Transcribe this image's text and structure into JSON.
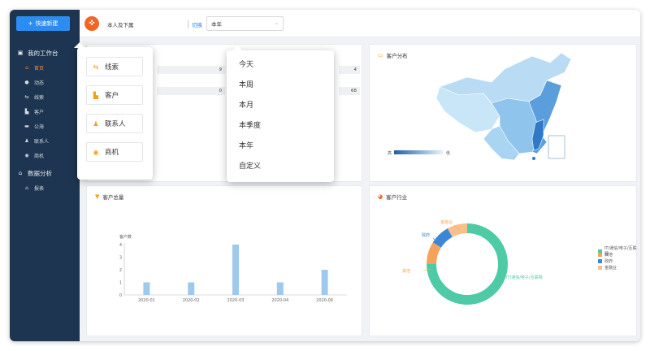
{
  "sidebar": {
    "quick_add": "快速新建",
    "items": [
      {
        "label": "我的工作台",
        "icon": "desktop-icon",
        "glyph": "▣",
        "group": true
      },
      {
        "label": "首页",
        "icon": "home-icon",
        "glyph": "⌂",
        "active": true
      },
      {
        "label": "动态",
        "icon": "chat-icon",
        "glyph": "●"
      },
      {
        "label": "线索",
        "icon": "link-icon",
        "glyph": "⇆"
      },
      {
        "label": "客户",
        "icon": "building-icon",
        "glyph": "▙"
      },
      {
        "label": "公海",
        "icon": "sea-icon",
        "glyph": "▬"
      },
      {
        "label": "联系人",
        "icon": "person-icon",
        "glyph": "♟"
      },
      {
        "label": "商机",
        "icon": "coin-icon",
        "glyph": "◉"
      },
      {
        "label": "数据分析",
        "icon": "home-icon",
        "glyph": "⌂",
        "group": true
      },
      {
        "label": "报表",
        "icon": "home-icon",
        "glyph": "⌂"
      }
    ]
  },
  "topbar": {
    "logo_glyph": "✜",
    "scope": "本人及下属",
    "switch": "切换",
    "period": "本年",
    "arrow": "⌄"
  },
  "panels": {
    "distribution": {
      "title": "客户分布",
      "icon": "monitor-icon",
      "glyph": "▭",
      "legend_high": "高",
      "legend_low": "低"
    },
    "total": {
      "title": "客户总量",
      "icon": "filter-icon",
      "glyph": "▼"
    },
    "industry": {
      "title": "客户行业",
      "icon": "pie-icon",
      "glyph": "◕"
    }
  },
  "stats": [
    {
      "left": "9",
      "right": "4"
    },
    {
      "left": "0",
      "right": "68"
    }
  ],
  "shortcut_menu": [
    {
      "label": "线索",
      "icon": "link-icon",
      "glyph": "⇆",
      "color": "#f0a020"
    },
    {
      "label": "客户",
      "icon": "building-icon",
      "glyph": "▙",
      "color": "#f0a020"
    },
    {
      "label": "联系人",
      "icon": "person-icon",
      "glyph": "♟",
      "color": "#f0a020"
    },
    {
      "label": "商机",
      "icon": "coin-icon",
      "glyph": "◉",
      "color": "#f0a020"
    }
  ],
  "period_options": [
    "今天",
    "本周",
    "本月",
    "本季度",
    "本年",
    "自定义"
  ],
  "colors": {
    "sidebar": "#1d3550",
    "accent": "#2d8cf0",
    "active": "#ff8a3d",
    "bar": "#9ec9ee",
    "map": "#a7d3f2"
  },
  "chart_data": [
    {
      "type": "bar",
      "ylabel": "客户数",
      "categories": [
        "2020-01",
        "2020-02",
        "2020-03",
        "2020-04",
        "2020-06"
      ],
      "values": [
        1,
        1,
        4,
        1,
        2
      ],
      "yticks": [
        0,
        1,
        2,
        3,
        4
      ],
      "ylim": [
        0,
        4
      ],
      "grid": false
    },
    {
      "type": "pie",
      "variant": "donut",
      "slices": [
        {
          "label": "IT/通信/电子/互联网",
          "value": 75,
          "color": "#4ecba6"
        },
        {
          "label": "其他",
          "value": 9,
          "color": "#f5a35c"
        },
        {
          "label": "政府",
          "value": 8,
          "color": "#3b86d6"
        },
        {
          "label": "金融业",
          "value": 8,
          "color": "#f7c08a"
        }
      ],
      "callouts": [
        "IT/通信/电子/互联网",
        "其他",
        "政府",
        "金融业"
      ],
      "legend": [
        "IT/通信/电子/互联网",
        "其他",
        "政府",
        "金融业"
      ],
      "legend_position": "right"
    }
  ]
}
